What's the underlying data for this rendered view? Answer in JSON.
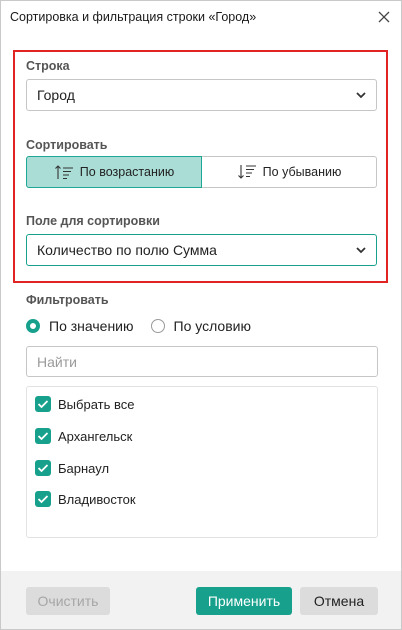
{
  "dialog": {
    "title": "Сортировка и фильтрация строки «Город»"
  },
  "row": {
    "label": "Строка",
    "value": "Город"
  },
  "sort": {
    "label": "Сортировать",
    "ascending_label": "По возрастанию",
    "descending_label": "По убыванию",
    "selected": "ascending"
  },
  "sort_field": {
    "label": "Поле для сортировки",
    "value": "Количество по полю Сумма"
  },
  "filter": {
    "label": "Фильтровать",
    "by_value_label": "По значению",
    "by_condition_label": "По условию",
    "selected": "by_value",
    "search_placeholder": "Найти",
    "items": [
      {
        "label": "Выбрать все",
        "checked": true
      },
      {
        "label": "Архангельск",
        "checked": true
      },
      {
        "label": "Барнаул",
        "checked": true
      },
      {
        "label": "Владивосток",
        "checked": true
      }
    ]
  },
  "footer": {
    "clear_label": "Очистить",
    "apply_label": "Применить",
    "cancel_label": "Отмена"
  },
  "colors": {
    "accent": "#17a18d",
    "active_segment": "#a9ddd6",
    "highlight_border": "#e02424"
  },
  "icons": {
    "close": "close-icon",
    "dropdown": "chevron-down-icon",
    "sort_ascending": "sort-ascending-icon",
    "sort_descending": "sort-descending-icon",
    "checkbox": "checkmark-icon"
  }
}
